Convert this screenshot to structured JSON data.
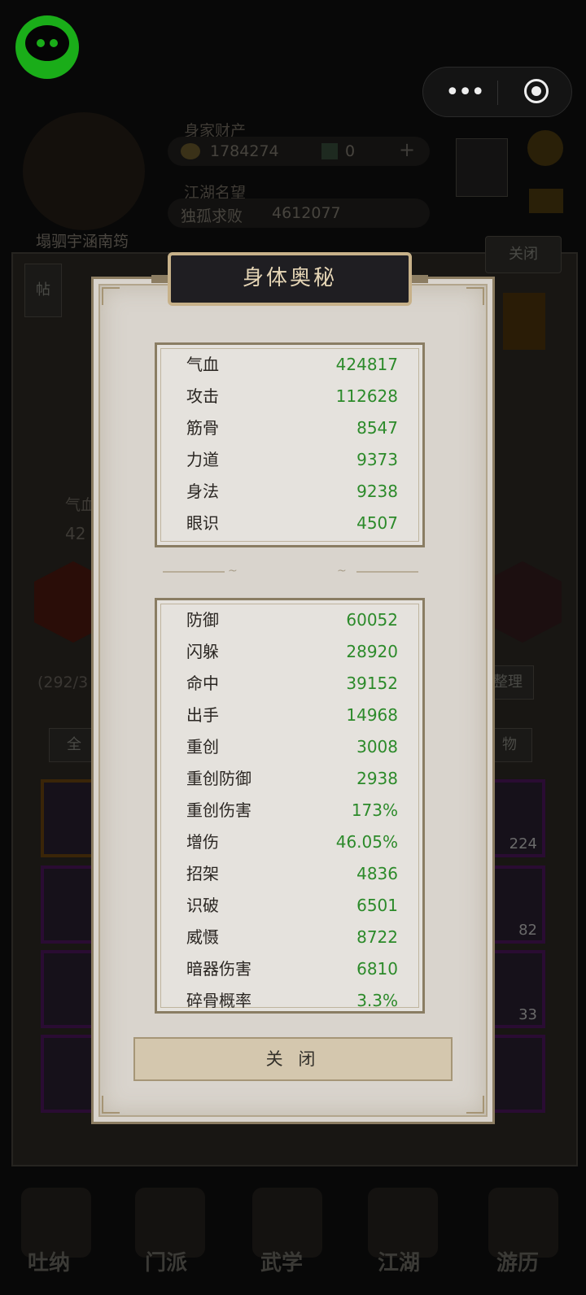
{
  "background": {
    "assets_label": "身家财产",
    "coins": "1784274",
    "jade": "0",
    "reputation_label": "江湖名望",
    "reputation_title": "独孤求败",
    "reputation_value": "4612077",
    "player_name": "塌驷宇涵南筠",
    "post_button": "帖",
    "top_close": "关闭",
    "stat_peek": "气血",
    "stat_peek_value": "42",
    "inventory_count": "(292/3",
    "sort_button": "整理",
    "filter_all": "全",
    "filter_items": "物",
    "slot_counts": [
      "224",
      "82",
      "33"
    ],
    "nav": [
      "吐纳",
      "门派",
      "武学",
      "江湖",
      "游历"
    ]
  },
  "modal": {
    "title": "身体奥秘",
    "basic_stats": [
      {
        "name": "气血",
        "value": "424817"
      },
      {
        "name": "攻击",
        "value": "112628"
      },
      {
        "name": "筋骨",
        "value": "8547"
      },
      {
        "name": "力道",
        "value": "9373"
      },
      {
        "name": "身法",
        "value": "9238"
      },
      {
        "name": "眼识",
        "value": "4507"
      }
    ],
    "advanced_stats": [
      {
        "name": "防御",
        "value": "60052"
      },
      {
        "name": "闪躲",
        "value": "28920"
      },
      {
        "name": "命中",
        "value": "39152"
      },
      {
        "name": "出手",
        "value": "14968"
      },
      {
        "name": "重创",
        "value": "3008"
      },
      {
        "name": "重创防御",
        "value": "2938"
      },
      {
        "name": "重创伤害",
        "value": "173%"
      },
      {
        "name": "增伤",
        "value": "46.05%"
      },
      {
        "name": "招架",
        "value": "4836"
      },
      {
        "name": "识破",
        "value": "6501"
      },
      {
        "name": "威慑",
        "value": "8722"
      },
      {
        "name": "暗器伤害",
        "value": "6810"
      },
      {
        "name": "碎骨概率",
        "value": "3.3%"
      }
    ],
    "close_label": "关 闭"
  },
  "colors": {
    "stat_value": "#2c8a2a",
    "wechat_green": "#1aad19",
    "title_text": "#e6d6b6"
  }
}
